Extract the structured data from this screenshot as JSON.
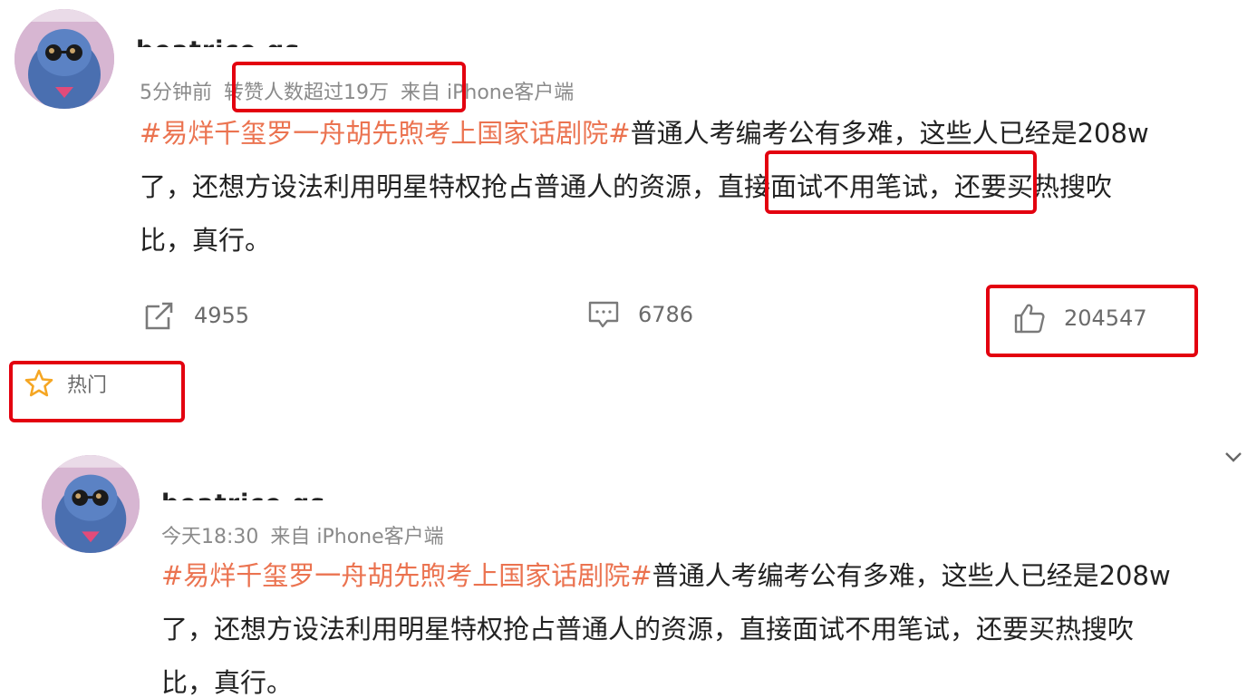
{
  "posts": [
    {
      "username": "beatrice qs",
      "meta": {
        "time": "5分钟前",
        "highlight": "转赞人数超过19万",
        "source": "来自 iPhone客户端"
      },
      "hashtag": "#易烊千玺罗一舟胡先煦考上国家话剧院#",
      "line1_rest": "普通人考编考公有多难，这些人已经是208w",
      "line2_pre": "了，还想方设法利用明星特权抢占普通人的资源，",
      "line2_boxed": "直接面试不用笔试，",
      "line2_post": "还要买热搜吹",
      "line3": "比，真行。",
      "actions": {
        "repost": "4955",
        "comment": "6786",
        "like": "204547"
      }
    },
    {
      "username": "beatrice qs",
      "meta": {
        "time": "今天18:30",
        "source": "来自 iPhone客户端"
      },
      "hashtag": "#易烊千玺罗一舟胡先煦考上国家话剧院#",
      "line1_rest": "普通人考编考公有多难，这些人已经是208w",
      "line2": "了，还想方设法利用明星特权抢占普通人的资源，直接面试不用笔试，还要买热搜吹",
      "line3": "比，真行。"
    }
  ],
  "hot_label": "热门",
  "icons": {
    "repost": "repost-icon",
    "comment": "comment-icon",
    "like": "thumbs-up-icon",
    "hot": "star-icon",
    "expand": "chevron-down-icon"
  },
  "colors": {
    "hashtag": "#eb7350",
    "highlight_box": "#e3000f",
    "meta": "#8a8a8a",
    "hot_star": "#f5a623"
  }
}
